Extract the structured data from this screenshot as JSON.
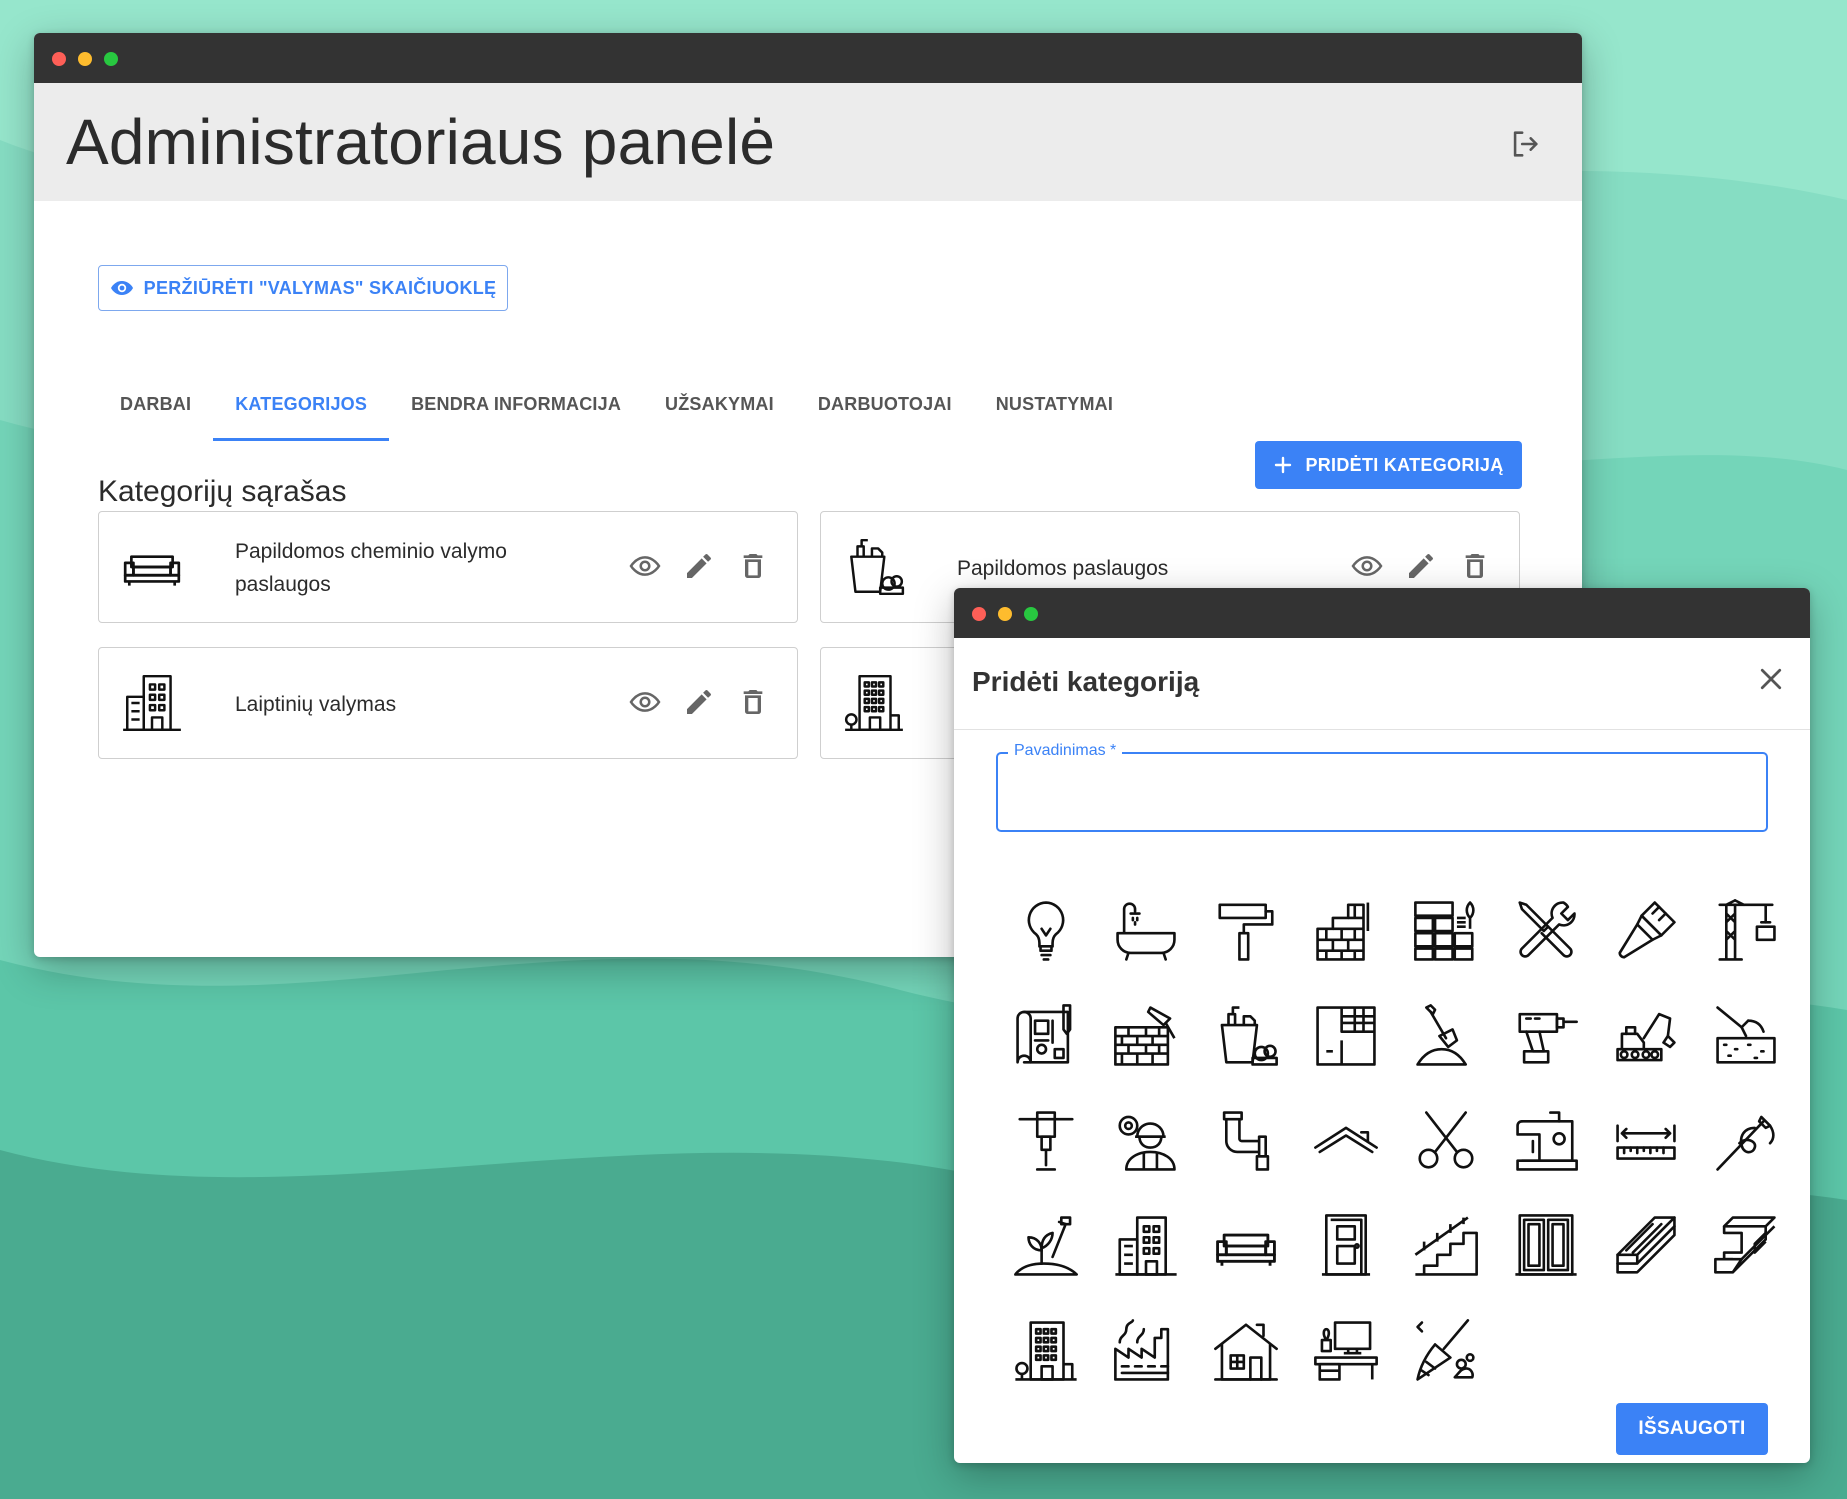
{
  "admin": {
    "title": "Administratoriaus panelė",
    "view_button_label": "PERŽIŪRĖTI \"VALYMAS\" SKAIČIUOKLĘ",
    "tabs": [
      {
        "label": "DARBAI",
        "active": false
      },
      {
        "label": "KATEGORIJOS",
        "active": true
      },
      {
        "label": "BENDRA INFORMACIJA",
        "active": false
      },
      {
        "label": "UŽSAKYMAI",
        "active": false
      },
      {
        "label": "DARBUOTOJAI",
        "active": false
      },
      {
        "label": "NUSTATYMAI",
        "active": false
      }
    ],
    "section_title": "Kategorijų sąrašas",
    "add_button_label": "PRIDĖTI KATEGORIJĄ",
    "categories": [
      {
        "label": "Papildomos cheminio valymo paslaugos",
        "icon": "sofa-icon"
      },
      {
        "label": "Papildomos paslaugos",
        "icon": "cleaning-supplies-icon"
      },
      {
        "label": "Laiptinių valymas",
        "icon": "apartment-building-icon"
      },
      {
        "label": "",
        "icon": "office-building-icon"
      }
    ]
  },
  "dialog": {
    "title": "Pridėti kategoriją",
    "field_label": "Pavadinimas *",
    "field_value": "",
    "save_label": "IŠSAUGOTI",
    "icons": [
      "lightbulb-icon",
      "bathtub-icon",
      "paint-roller-icon",
      "brick-wall-icon",
      "tiles-icon",
      "wrench-screwdriver-icon",
      "paintbrush-icon",
      "tower-crane-icon",
      "blueprint-icon",
      "bricklaying-icon",
      "cleaning-supplies-icon",
      "floor-plan-icon",
      "shovel-icon",
      "power-drill-icon",
      "excavator-icon",
      "concrete-pour-icon",
      "jackhammer-icon",
      "engineer-icon",
      "pipe-icon",
      "roof-icon",
      "scissors-icon",
      "sewing-machine-icon",
      "measuring-tape-icon",
      "needle-thread-icon",
      "gardening-icon",
      "apartment-building-icon",
      "sofa-icon",
      "door-icon",
      "stairs-icon",
      "window-icon",
      "wood-planks-icon",
      "steel-beam-icon",
      "office-building-icon",
      "factory-icon",
      "house-icon",
      "desk-icon",
      "broom-icon"
    ]
  },
  "colors": {
    "accent": "#3b82f6",
    "titlebar": "#333333",
    "header_bg": "#ececec",
    "background": "#5ccfb0"
  }
}
